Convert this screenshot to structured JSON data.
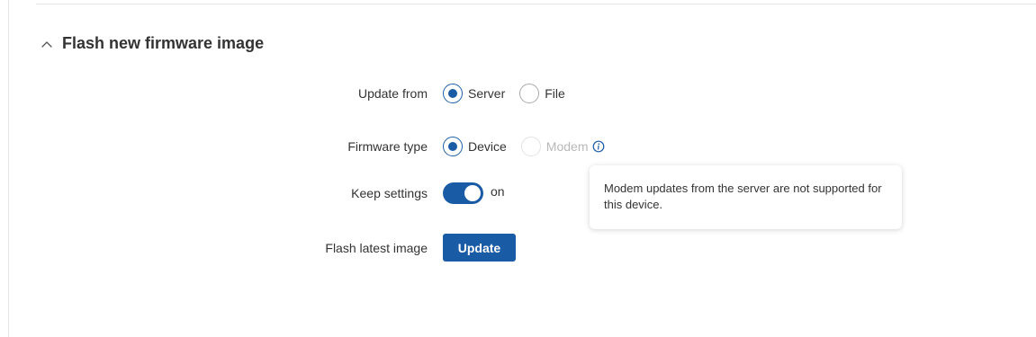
{
  "section": {
    "title": "Flash new firmware image",
    "collapse_icon": "chevron-up-icon"
  },
  "update_from": {
    "label": "Update from",
    "options": [
      {
        "label": "Server",
        "checked": true,
        "disabled": false
      },
      {
        "label": "File",
        "checked": false,
        "disabled": false
      }
    ]
  },
  "firmware_type": {
    "label": "Firmware type",
    "options": [
      {
        "label": "Device",
        "checked": true,
        "disabled": false
      },
      {
        "label": "Modem",
        "checked": false,
        "disabled": true
      }
    ],
    "info_icon": "info-icon"
  },
  "keep_settings": {
    "label": "Keep settings",
    "state": "on",
    "enabled": true
  },
  "flash_latest": {
    "label": "Flash latest image",
    "button_label": "Update"
  },
  "tooltip": {
    "text": "Modem updates from the server are not supported for this device."
  },
  "colors": {
    "accent": "#1a5ba5",
    "text": "#333333",
    "disabled_text": "#b8b8b8"
  }
}
